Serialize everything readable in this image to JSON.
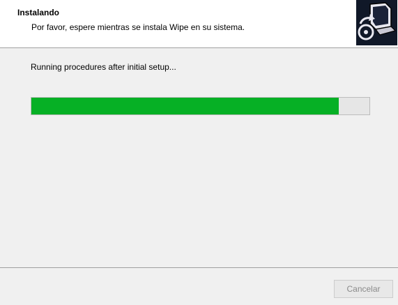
{
  "header": {
    "title": "Instalando",
    "subtitle": "Por favor, espere mientras se instala Wipe en su sistema.",
    "logo_icon": "installer-computer-icon"
  },
  "main": {
    "status_text": "Running procedures after initial setup...",
    "progress_fraction": 0.91,
    "progress_color": "#06b025"
  },
  "footer": {
    "cancel_label": "Cancelar",
    "cancel_enabled": false
  }
}
